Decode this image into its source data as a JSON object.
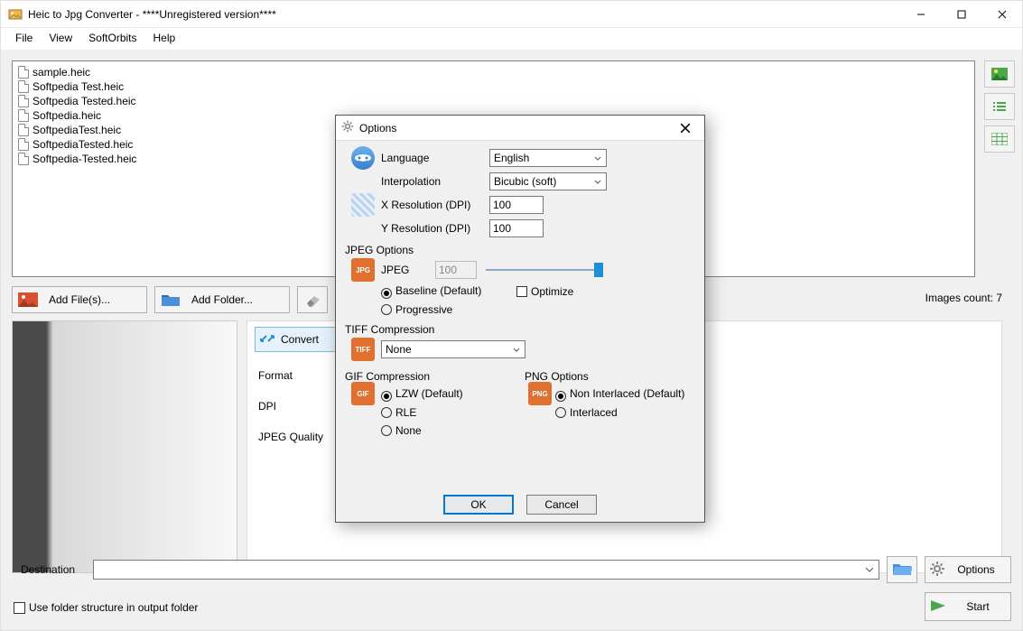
{
  "titlebar": {
    "title": "Heic to Jpg Converter - ****Unregistered version****"
  },
  "menu": {
    "file": "File",
    "view": "View",
    "softorbits": "SoftOrbits",
    "help": "Help"
  },
  "files": [
    "sample.heic",
    "Softpedia Test.heic",
    "Softpedia Tested.heic",
    "Softpedia.heic",
    "SoftpediaTest.heic",
    "SoftpediaTested.heic",
    "Softpedia-Tested.heic"
  ],
  "actions": {
    "add_files": "Add File(s)...",
    "add_folder": "Add Folder..."
  },
  "images_count_label": "Images count: 7",
  "tabs": {
    "convert": "Convert",
    "format": "Format",
    "dpi": "DPI",
    "jpeg_quality": "JPEG Quality"
  },
  "destination": {
    "label": "Destination",
    "options": "Options"
  },
  "folder_checkbox": "Use folder structure in output folder",
  "start": "Start",
  "dialog": {
    "title": "Options",
    "language": {
      "label": "Language",
      "value": "English"
    },
    "interpolation": {
      "label": "Interpolation",
      "value": "Bicubic (soft)"
    },
    "xres": {
      "label": "X Resolution (DPI)",
      "value": "100"
    },
    "yres": {
      "label": "Y Resolution (DPI)",
      "value": "100"
    },
    "jpeg": {
      "section": "JPEG Options",
      "label": "JPEG",
      "value": "100",
      "baseline": "Baseline (Default)",
      "progressive": "Progressive",
      "optimize": "Optimize"
    },
    "tiff": {
      "section": "TIFF Compression",
      "value": "None"
    },
    "gif": {
      "section": "GIF Compression",
      "lzw": "LZW (Default)",
      "rle": "RLE",
      "none": "None"
    },
    "png": {
      "section": "PNG Options",
      "noninterlaced": "Non Interlaced (Default)",
      "interlaced": "Interlaced"
    },
    "ok": "OK",
    "cancel": "Cancel"
  }
}
